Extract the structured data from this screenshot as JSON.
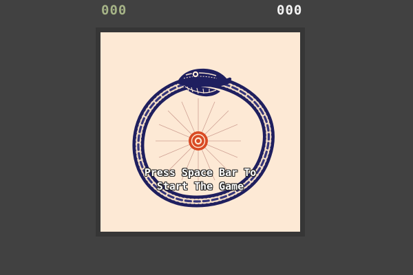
{
  "scores": {
    "player_one": "000",
    "player_two": "000"
  },
  "message": {
    "text": "Press Space Bar To\nStart The Game"
  },
  "colors": {
    "background": "#414141",
    "board_frame": "#363636",
    "board_field": "#fde9d5",
    "snake": "#1f1f5f",
    "sun": "#d94b24",
    "player_one_score": "#a6b487",
    "player_two_score": "#f4f4f4"
  },
  "icons": {
    "emblem": "ouroboros-snake-icon",
    "center": "sun-icon"
  }
}
